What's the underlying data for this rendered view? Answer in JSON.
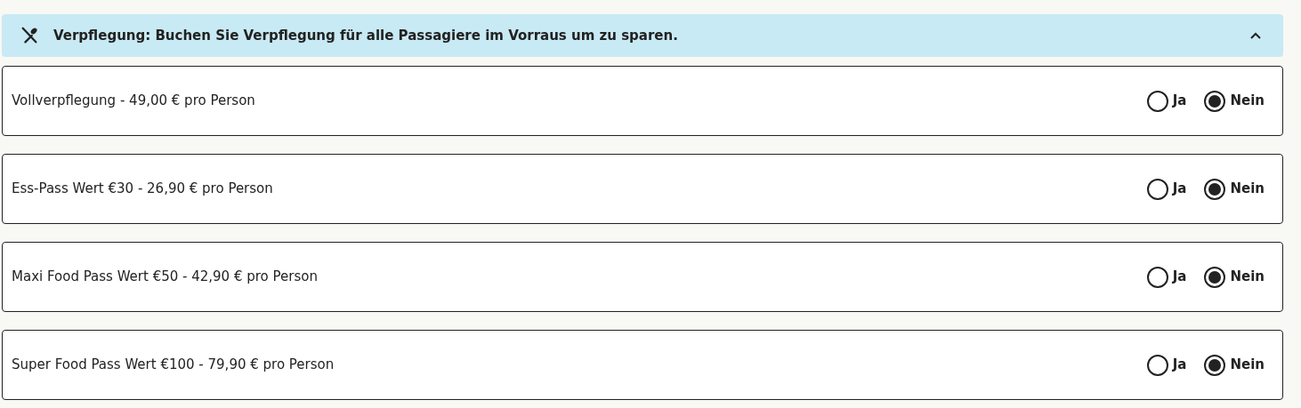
{
  "section": {
    "title": "Verpflegung: Buchen Sie Verpflegung für alle Passagiere im Vorraus um zu sparen.",
    "expanded": true
  },
  "options": [
    {
      "label": "Vollverpflegung - 49,00 € pro Person",
      "choices": [
        {
          "label": "Ja",
          "selected": false
        },
        {
          "label": "Nein",
          "selected": true
        }
      ]
    },
    {
      "label": "Ess-Pass Wert €30 - 26,90 € pro Person",
      "choices": [
        {
          "label": "Ja",
          "selected": false
        },
        {
          "label": "Nein",
          "selected": true
        }
      ]
    },
    {
      "label": "Maxi Food Pass Wert €50 - 42,90 € pro Person",
      "choices": [
        {
          "label": "Ja",
          "selected": false
        },
        {
          "label": "Nein",
          "selected": true
        }
      ]
    },
    {
      "label": "Super Food Pass Wert €100 - 79,90 € pro Person",
      "choices": [
        {
          "label": "Ja",
          "selected": false
        },
        {
          "label": "Nein",
          "selected": true
        }
      ]
    }
  ]
}
